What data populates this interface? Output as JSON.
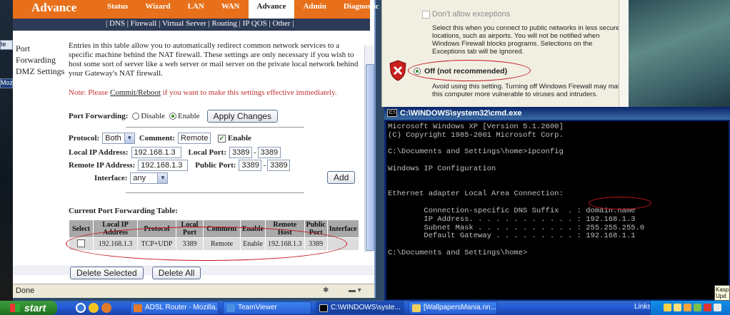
{
  "desktop": {
    "left_stubs": [
      "te",
      "Mozi"
    ]
  },
  "browser": {
    "brand": "Advance",
    "menu": [
      "Status",
      "Wizard",
      "LAN",
      "WAN",
      "Advance",
      "Admin",
      "Diagnostic"
    ],
    "active_menu": "Advance",
    "subnav": "| DNS | Firewall | Virtual Server | Routing | IP QOS | Other |",
    "side_menu": [
      "Port",
      "Forwarding",
      "DMZ Settings"
    ],
    "description": "Entries in this table allow you to automatically redirect common network services to a specific machine behind the NAT firewall. These settings are only necessary if you wish to host some sort of server like a web server or mail server on the private local network behind your Gateway's NAT firewall.",
    "note_prefix": "Note: Please ",
    "note_link": "Commit/Reboot",
    "note_suffix": " if you want to make this settings effective immediately.",
    "port_forwarding_label": "Port Forwarding:",
    "disable_label": "Disable",
    "enable_label": "Enable",
    "apply_button": "Apply Changes",
    "protocol_label": "Protocol:",
    "protocol_value": "Both",
    "comment_label": "Comment:",
    "comment_value": "Remote",
    "enable_checkbox_label": "Enable",
    "local_ip_label": "Local IP Address:",
    "local_ip_value": "192.168.1.3",
    "local_port_label": "Local Port:",
    "local_port_from": "3389",
    "local_port_to": "3389",
    "remote_ip_label": "Remote IP Address:",
    "remote_ip_value": "192.168.1.3",
    "public_port_label": "Public Port:",
    "public_port_from": "3389",
    "public_port_to": "3389",
    "interface_label": "Interface:",
    "interface_value": "any",
    "add_button": "Add",
    "table_title": "Current Port Forwarding Table:",
    "table_headers": [
      "Select",
      "Local IP Address",
      "Protocol",
      "Local Port",
      "Comment",
      "Enable",
      "Remote Host",
      "Public Port",
      "Interface"
    ],
    "table_row": {
      "local_ip": "192.168.1.3",
      "protocol": "TCP+UDP",
      "local_port": "3389",
      "comment": "Remote",
      "enable": "Enable",
      "remote_host": "192.168.1.3",
      "public_port": "3389",
      "interface": ""
    },
    "delete_selected_button": "Delete Selected",
    "delete_all_button": "Delete All",
    "status": "Done"
  },
  "firewall": {
    "dont_allow_label": "Don't allow exceptions",
    "dont_allow_desc": "Select this when you connect to public networks in less secure locations, such as airports. You will not be notified when Windows Firewall blocks programs. Selections on the Exceptions tab will be ignored.",
    "off_label": "Off (not recommended)",
    "off_desc": "Avoid using this setting. Turning off Windows Firewall may make this computer more vulnerable to viruses and intruders."
  },
  "cmd": {
    "title": "C:\\WINDOWS\\system32\\cmd.exe",
    "output": "Microsoft Windows XP [Version 5.1.2600]\n(C) Copyright 1985-2001 Microsoft Corp.\n\nC:\\Documents and Settings\\home>ipconfig\n\nWindows IP Configuration\n\n\nEthernet adapter Local Area Connection:\n\n        Connection-specific DNS Suffix  . : domain.name\n        IP Address. . . . . . . . . . . . : 192.168.1.3\n        Subnet Mask . . . . . . . . . . . : 255.255.255.0\n        Default Gateway . . . . . . . . . : 192.168.1.1\n\nC:\\Documents and Settings\\home>"
  },
  "taskbar": {
    "start_label": "start",
    "tasks": [
      "ADSL Router - Mozilla...",
      "TeamViewer",
      "C:\\WINDOWS\\syste...",
      "[WallpapersMania.nn..."
    ],
    "links_label": "Links",
    "tray_tooltip": "Kasp",
    "tray_tooltip2": "Upd"
  },
  "colors": {
    "router_orange": "#e8701a",
    "router_subnav": "#2d3b57",
    "annotation_red": "#c4141c",
    "xp_blue": "#245edb",
    "xp_start_green": "#2e8b2e"
  }
}
